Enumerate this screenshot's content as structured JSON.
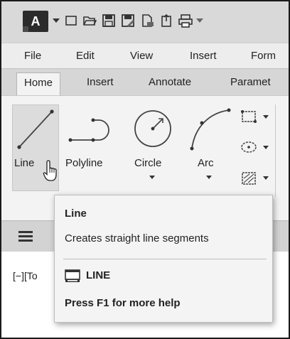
{
  "app": {
    "logo_letter": "A"
  },
  "quick_access": {
    "icons": [
      "new-icon",
      "open-icon",
      "save-icon",
      "save-as-icon",
      "export-icon",
      "share-icon",
      "print-icon"
    ]
  },
  "menubar": {
    "items": [
      "File",
      "Edit",
      "View",
      "Insert",
      "Form"
    ]
  },
  "ribbon_tabs": {
    "items": [
      "Home",
      "Insert",
      "Annotate",
      "Paramet"
    ],
    "active": "Home"
  },
  "tools": {
    "line": "Line",
    "polyline": "Polyline",
    "circle": "Circle",
    "arc": "Arc"
  },
  "viewport": {
    "label": "[−][To"
  },
  "tooltip": {
    "title": "Line",
    "description": "Creates straight line segments",
    "command": "LINE",
    "help": "Press F1 for more help"
  },
  "colors": {
    "accent_dark": "#2b2b2b",
    "ribbon_bg": "#f3f3f3",
    "tooltip_bg": "#f4f4f4"
  }
}
